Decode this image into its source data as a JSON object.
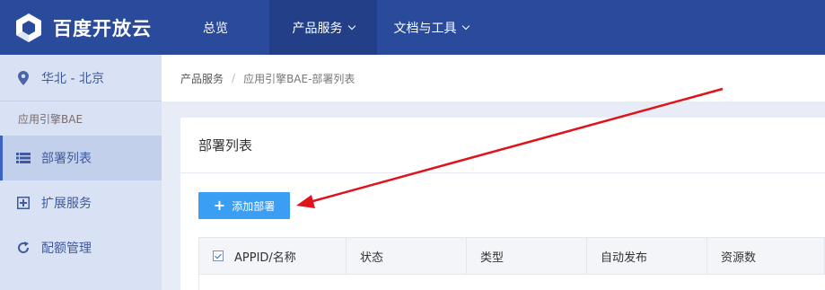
{
  "colors": {
    "nav_bg": "#2a4a9b",
    "nav_active": "#223f88",
    "sidebar_bg": "#d9e1f4",
    "accent": "#3a9ef5",
    "annotation": "#e0121a"
  },
  "topnav": {
    "brand": "百度开放云",
    "items": [
      {
        "label": "总览",
        "dropdown": false
      },
      {
        "label": "产品服务",
        "dropdown": true,
        "active": true
      },
      {
        "label": "文档与工具",
        "dropdown": true
      }
    ]
  },
  "sidebar": {
    "region": {
      "icon": "location-pin-icon",
      "label": "华北 - 北京"
    },
    "section": "应用引擎BAE",
    "items": [
      {
        "icon": "list-icon",
        "label": "部署列表",
        "active": true
      },
      {
        "icon": "plus-square-icon",
        "label": "扩展服务"
      },
      {
        "icon": "refresh-icon",
        "label": "配额管理"
      }
    ]
  },
  "breadcrumb": {
    "root": "产品服务",
    "separator": "/",
    "current": "应用引擎BAE-部署列表"
  },
  "card": {
    "title": "部署列表",
    "add_button": {
      "icon": "plus-icon",
      "label": "添加部署"
    },
    "table": {
      "header_checkbox_checked": true,
      "columns": [
        "APPID/名称",
        "状态",
        "类型",
        "自动发布",
        "资源数"
      ]
    }
  }
}
